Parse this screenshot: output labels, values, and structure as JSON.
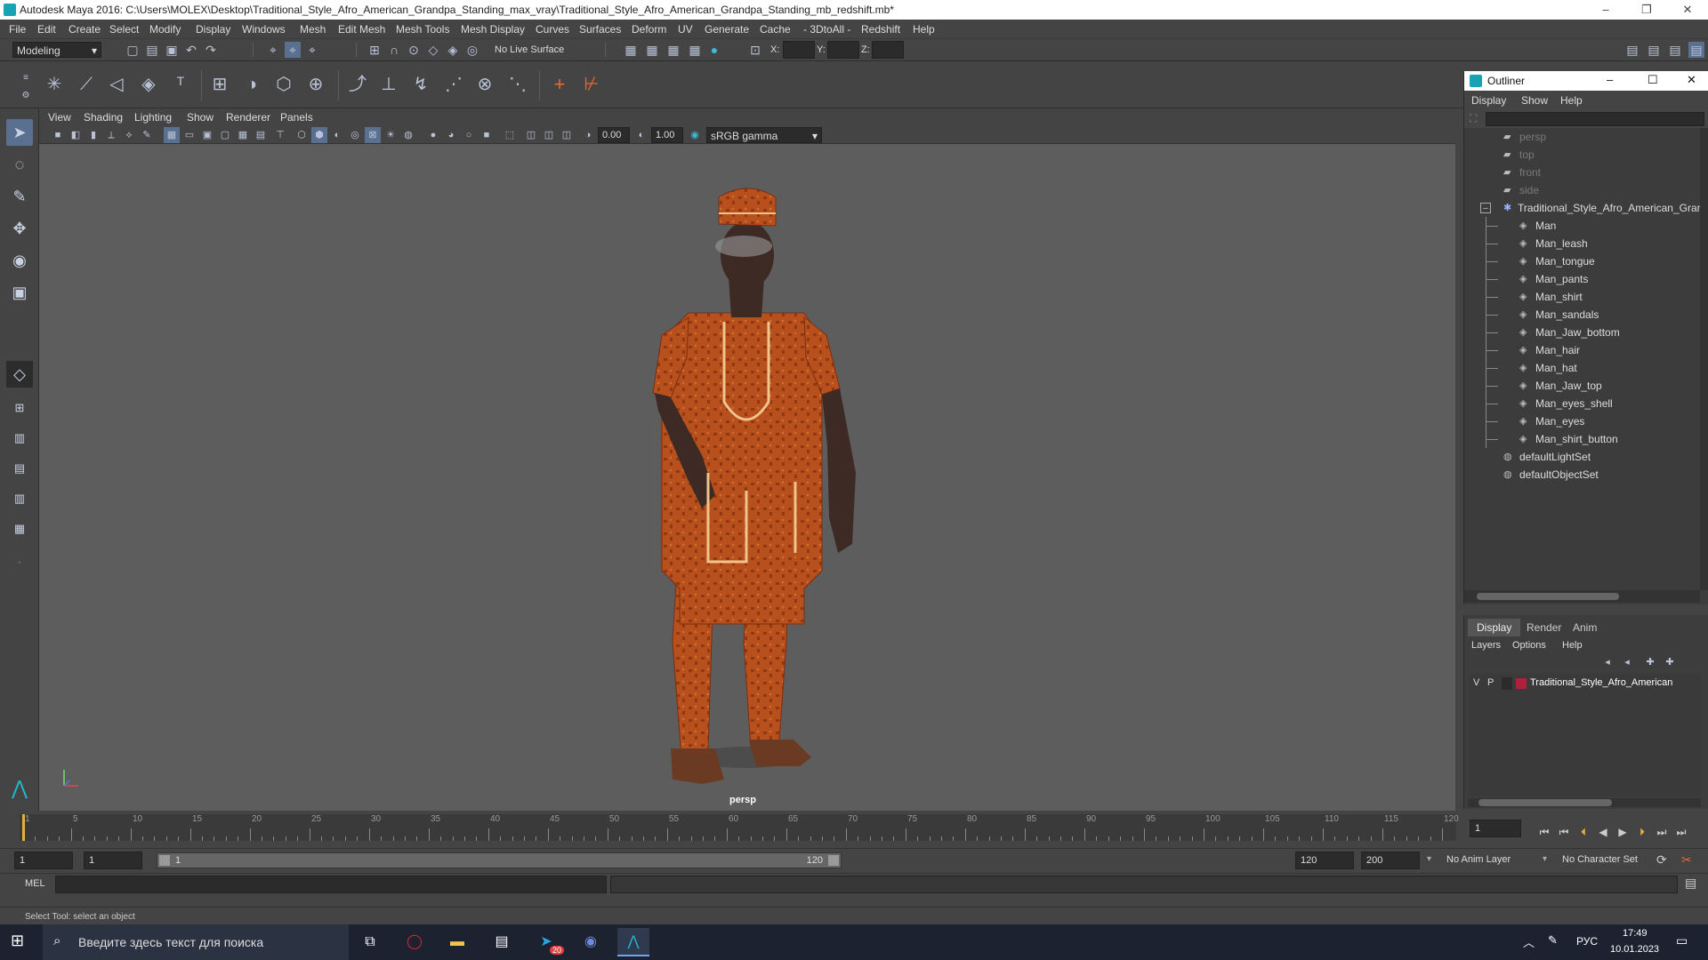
{
  "window": {
    "title": "Autodesk Maya 2016: C:\\Users\\MOLEX\\Desktop\\Traditional_Style_Afro_American_Grandpa_Standing_max_vray\\Traditional_Style_Afro_American_Grandpa_Standing_mb_redshift.mb*",
    "minimize": "–",
    "restore": "❐",
    "close": "✕"
  },
  "menubar": [
    "File",
    "Edit",
    "Create",
    "Select",
    "Modify",
    "Display",
    "Windows",
    "Mesh",
    "Edit Mesh",
    "Mesh Tools",
    "Mesh Display",
    "Curves",
    "Surfaces",
    "Deform",
    "UV",
    "Generate",
    "Cache",
    "- 3DtoAll -",
    "Redshift",
    "Help"
  ],
  "statusline": {
    "mode": "Modeling",
    "live_surface": "No Live Surface",
    "x_label": "X:",
    "y_label": "Y:",
    "z_label": "Z:"
  },
  "panel_menu": [
    "View",
    "Shading",
    "Lighting",
    "Show",
    "Renderer",
    "Panels"
  ],
  "panel_toolbar": {
    "exposure": "0.00",
    "gamma": "1.00",
    "color_space": "sRGB gamma"
  },
  "viewport": {
    "camera_label": "persp",
    "bg_color": "#5d5d5d"
  },
  "outliner": {
    "title": "Outliner",
    "menu": [
      "Display",
      "Show",
      "Help"
    ],
    "cameras": [
      "persp",
      "top",
      "front",
      "side"
    ],
    "root": "Traditional_Style_Afro_American_Granc",
    "children": [
      "Man",
      "Man_leash",
      "Man_tongue",
      "Man_pants",
      "Man_shirt",
      "Man_sandals",
      "Man_Jaw_bottom",
      "Man_hair",
      "Man_hat",
      "Man_Jaw_top",
      "Man_eyes_shell",
      "Man_eyes",
      "Man_shirt_button"
    ],
    "sets": [
      "defaultLightSet",
      "defaultObjectSet"
    ]
  },
  "layers": {
    "tabs": [
      "Display",
      "Render",
      "Anim"
    ],
    "menu": [
      "Layers",
      "Options",
      "Help"
    ],
    "layer": {
      "v": "V",
      "p": "P",
      "name": "Traditional_Style_Afro_American",
      "color": "#b0203a"
    }
  },
  "timeline": {
    "ticks": [
      "1",
      "5",
      "10",
      "15",
      "20",
      "25",
      "30",
      "35",
      "40",
      "45",
      "50",
      "55",
      "60",
      "65",
      "70",
      "75",
      "80",
      "85",
      "90",
      "95",
      "100",
      "105",
      "110",
      "115",
      "120"
    ],
    "current_frame": "1"
  },
  "range": {
    "start": "1",
    "start2": "1",
    "slider_start": "1",
    "slider_end": "120",
    "end": "120",
    "end2": "200",
    "anim_layer": "No Anim Layer",
    "char_set": "No Character Set"
  },
  "mel": {
    "label": "MEL"
  },
  "help_line": "Select Tool: select an object",
  "taskbar": {
    "search_placeholder": "Введите здесь текст для поиска",
    "lang": "РУС",
    "time": "17:49",
    "date": "10.01.2023",
    "telegram_badge": "20"
  }
}
